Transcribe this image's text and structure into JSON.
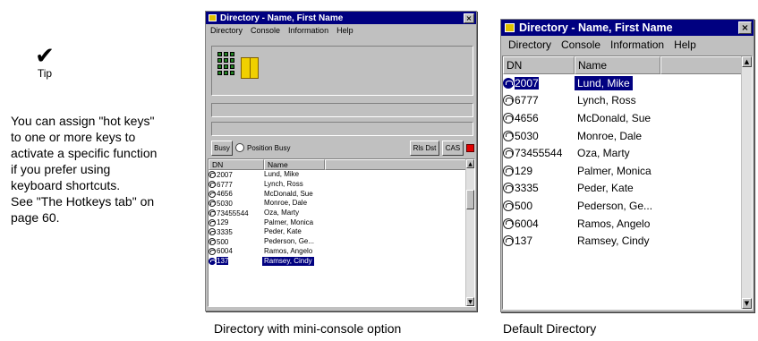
{
  "tip": {
    "label": "Tip",
    "lines": [
      "You can assign \"hot keys\"",
      "to one or more keys to",
      "activate a specific function",
      "if you prefer using",
      "keyboard shortcuts.",
      "See \"The Hotkeys tab\" on",
      "page 60."
    ]
  },
  "mini_window": {
    "title": "Directory - Name, First Name",
    "menu": [
      "Directory",
      "Console",
      "Information",
      "Help"
    ],
    "busy_label": "Busy",
    "position_busy_label": "Position Busy",
    "rls_label": "Rls Dst",
    "cas_label": "CAS",
    "columns": [
      "DN",
      "Name"
    ],
    "rows": [
      {
        "dn": "2007",
        "name": "Lund, Mike"
      },
      {
        "dn": "6777",
        "name": "Lynch, Ross"
      },
      {
        "dn": "4656",
        "name": "McDonald, Sue"
      },
      {
        "dn": "5030",
        "name": "Monroe, Dale"
      },
      {
        "dn": "73455544",
        "name": "Oza, Marty"
      },
      {
        "dn": "129",
        "name": "Palmer, Monica"
      },
      {
        "dn": "3335",
        "name": "Peder, Kate"
      },
      {
        "dn": "500",
        "name": "Pederson, Ge..."
      },
      {
        "dn": "6004",
        "name": "Ramos, Angelo"
      },
      {
        "dn": "137",
        "name": "Ramsey, Cindy"
      }
    ],
    "selected_index": 9
  },
  "default_window": {
    "title": "Directory - Name, First Name",
    "menu": [
      "Directory",
      "Console",
      "Information",
      "Help"
    ],
    "columns": [
      "DN",
      "Name"
    ],
    "rows": [
      {
        "dn": "2007",
        "name": "Lund, Mike"
      },
      {
        "dn": "6777",
        "name": "Lynch, Ross"
      },
      {
        "dn": "4656",
        "name": "McDonald, Sue"
      },
      {
        "dn": "5030",
        "name": "Monroe, Dale"
      },
      {
        "dn": "73455544",
        "name": "Oza, Marty"
      },
      {
        "dn": "129",
        "name": "Palmer, Monica"
      },
      {
        "dn": "3335",
        "name": "Peder, Kate"
      },
      {
        "dn": "500",
        "name": "Pederson, Ge..."
      },
      {
        "dn": "6004",
        "name": "Ramos, Angelo"
      },
      {
        "dn": "137",
        "name": "Ramsey, Cindy"
      }
    ],
    "selected_index": 0
  },
  "captions": {
    "mini": "Directory with mini-console option",
    "default": "Default Directory"
  },
  "colors": {
    "titlebar": "#000080",
    "selection": "#000080",
    "cas_indicator": "#e00000"
  },
  "icons": {
    "tip": "checkmark-icon",
    "title": "directory-app-icon",
    "row": "phone-icon"
  }
}
